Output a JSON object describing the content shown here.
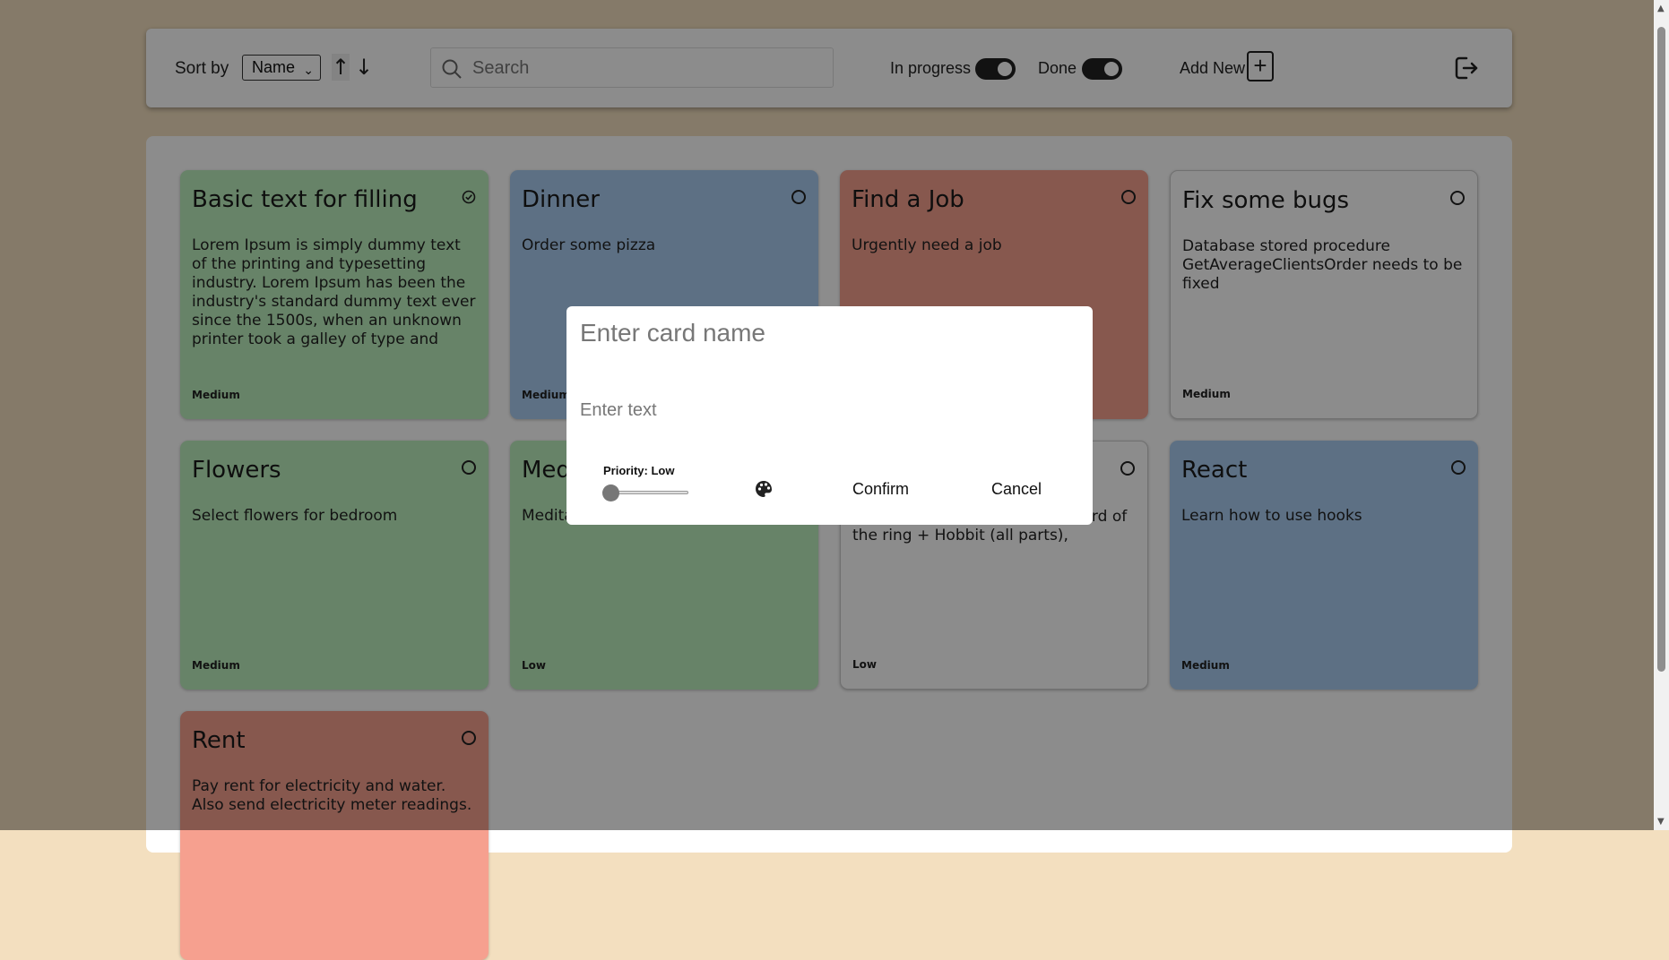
{
  "toolbar": {
    "sort_label": "Sort by",
    "sort_value": "Name",
    "sort_up": "↑",
    "sort_down": "↓",
    "search_placeholder": "Search",
    "in_progress_label": "In progress",
    "done_label": "Done",
    "add_new_label": "Add New",
    "add_button": "+"
  },
  "cards": [
    {
      "title": "Basic text for filling",
      "text": "Lorem Ipsum is simply dummy text of the printing and typesetting industry. Lorem Ipsum has been the industry's standard dummy text ever since the 1500s, when an unknown printer took a galley of type and scrambled it to make a type specimen book. It has survived",
      "priority": "Medium",
      "color": "#bcefbd",
      "checked": true
    },
    {
      "title": "Dinner",
      "text": "Order some pizza",
      "priority": "Medium",
      "color": "#a9ccf0",
      "checked": false
    },
    {
      "title": "Find a Job",
      "text": "Urgently need a job",
      "priority": "",
      "color": "#f6a08f",
      "checked": false
    },
    {
      "title": "Fix some bugs",
      "text": "Database stored procedure GetAverageClientsOrder needs to be fixed",
      "priority": "Medium",
      "color": "#ffffff",
      "checked": false
    },
    {
      "title": "Flowers",
      "text": "Select flowers for bedroom",
      "priority": "Medium",
      "color": "#bcefbd",
      "checked": false
    },
    {
      "title": "Med",
      "text": "Medita",
      "priority": "Low",
      "color": "#bcefbd",
      "checked": false
    },
    {
      "title": "",
      "text": "nter: Harry Potter (all parts), Lord of the ring + Hobbit (all parts),",
      "priority": "Low",
      "color": "#ffffff",
      "checked": false
    },
    {
      "title": "React",
      "text": "Learn how to use hooks",
      "priority": "Medium",
      "color": "#a9ccf0",
      "checked": false
    },
    {
      "title": "Rent",
      "text": "Pay rent for electricity and water. Also send electricity meter readings.",
      "priority": "",
      "color": "#f6a08f",
      "checked": false
    }
  ],
  "modal": {
    "name_placeholder": "Enter card name",
    "text_placeholder": "Enter text",
    "priority_label": "Priority: Low",
    "priority_value": 0,
    "confirm_label": "Confirm",
    "cancel_label": "Cancel"
  }
}
